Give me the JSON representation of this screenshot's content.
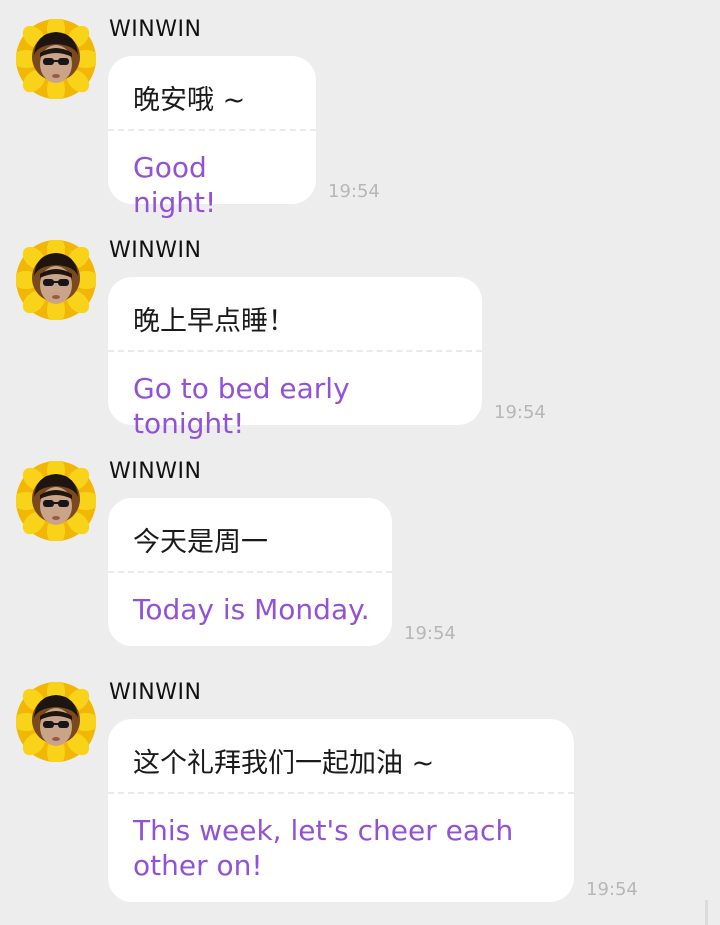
{
  "chat": {
    "messages": [
      {
        "sender": "WINWIN",
        "original": "晚安哦 ~",
        "translation": "Good night!",
        "time": "19:54"
      },
      {
        "sender": "WINWIN",
        "original": "晚上早点睡！",
        "translation": "Go to bed early tonight!",
        "time": "19:54"
      },
      {
        "sender": "WINWIN",
        "original": "今天是周一",
        "translation": "Today is Monday.",
        "time": "19:54"
      },
      {
        "sender": "WINWIN",
        "original": "这个礼拜我们一起加油 ~",
        "translation": "This week, let's cheer each other on!",
        "time": "19:54"
      }
    ]
  },
  "colors": {
    "background": "#ededed",
    "bubble": "#ffffff",
    "translation_text": "#9152d8",
    "timestamp": "#b7b7b7",
    "sunflower_petals": "#f4c20d"
  },
  "icons": {
    "avatar": "sunflower-avatar"
  }
}
